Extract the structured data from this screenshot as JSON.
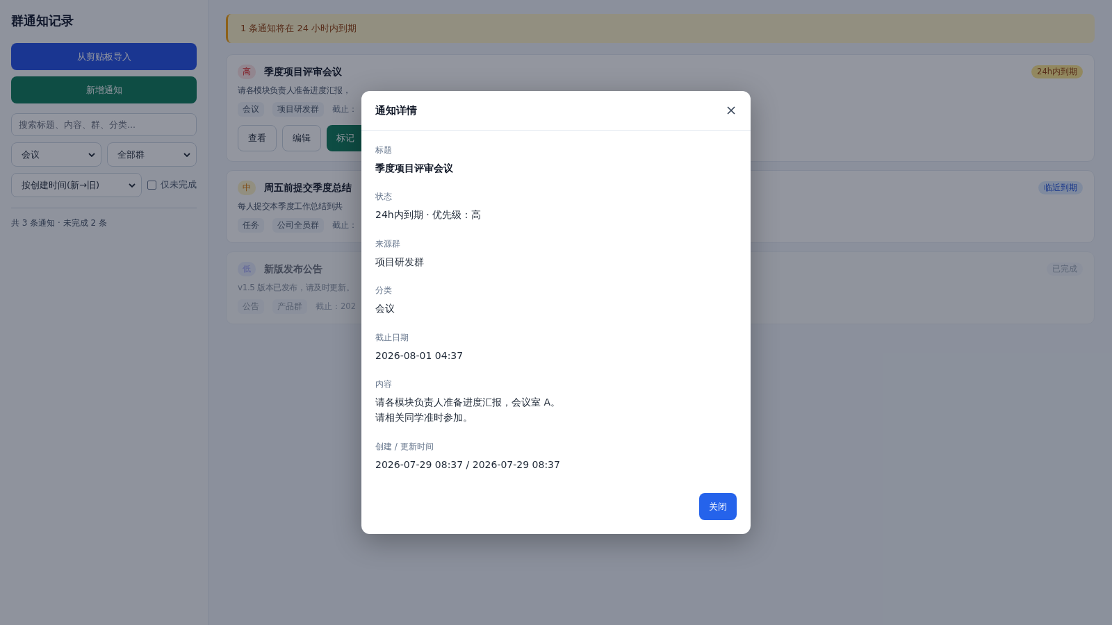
{
  "sidebar": {
    "title": "群通知记录",
    "buttons": [
      {
        "label": "从剪贴板导入",
        "kind": "primary"
      },
      {
        "label": "新增通知",
        "kind": "success"
      }
    ],
    "search": {
      "placeholder": "搜索标题、内容、群、分类..."
    },
    "category_select": {
      "value": "会议"
    },
    "group_select": {
      "value": "全部群"
    },
    "sort_select": {
      "value": "按创建时间(新→旧)"
    },
    "only_incomplete": {
      "label": "仅未完成",
      "checked": false
    },
    "summary": "共 3 条通知 · 未完成 2 条"
  },
  "alert": "1 条通知将在 24 小时内到期",
  "notices": [
    {
      "priority": {
        "label": "高",
        "kind": "high"
      },
      "title": "季度项目评审会议",
      "description": "请各模块负责人准备进度汇报，",
      "tags": [
        "会议",
        "项目研发群"
      ],
      "due": "截止：",
      "status": {
        "label": "24h内到期",
        "kind": "urgent"
      },
      "done": false,
      "actions": [
        {
          "label": "查看",
          "kind": "outline"
        },
        {
          "label": "编辑",
          "kind": "outline"
        },
        {
          "label": "标记",
          "kind": "success"
        }
      ]
    },
    {
      "priority": {
        "label": "中",
        "kind": "medium"
      },
      "title": "周五前提交季度总结",
      "description": "每人提交本季度工作总结到共",
      "tags": [
        "任务",
        "公司全员群"
      ],
      "due": "截止：",
      "status": {
        "label": "临近到期",
        "kind": "soon"
      },
      "done": false
    },
    {
      "priority": {
        "label": "低",
        "kind": "low"
      },
      "title": "新版发布公告",
      "description": "v1.5 版本已发布，请及时更新。",
      "tags": [
        "公告",
        "产品群"
      ],
      "due": "截止：202",
      "status": {
        "label": "已完成",
        "kind": "done"
      },
      "done": true
    }
  ],
  "modal": {
    "title": "通知详情",
    "fields": [
      {
        "label": "标题",
        "value": "季度项目评审会议",
        "kind": "strong"
      },
      {
        "label": "状态",
        "value": "24h内到期 · 优先级：高",
        "kind": "plain"
      },
      {
        "label": "来源群",
        "value": "项目研发群",
        "kind": "plain"
      },
      {
        "label": "分类",
        "value": "会议",
        "kind": "plain"
      },
      {
        "label": "截止日期",
        "value": "2026-08-01 04:37",
        "kind": "plain"
      },
      {
        "label": "内容",
        "lines": [
          "请各模块负责人准备进度汇报，会议室 A。",
          "请相关同学准时参加。"
        ],
        "kind": "plain"
      },
      {
        "label": "创建 / 更新时间",
        "value": "2026-07-29 08:37 / 2026-07-29 08:37",
        "kind": "plain"
      }
    ],
    "close_button": "关闭"
  }
}
